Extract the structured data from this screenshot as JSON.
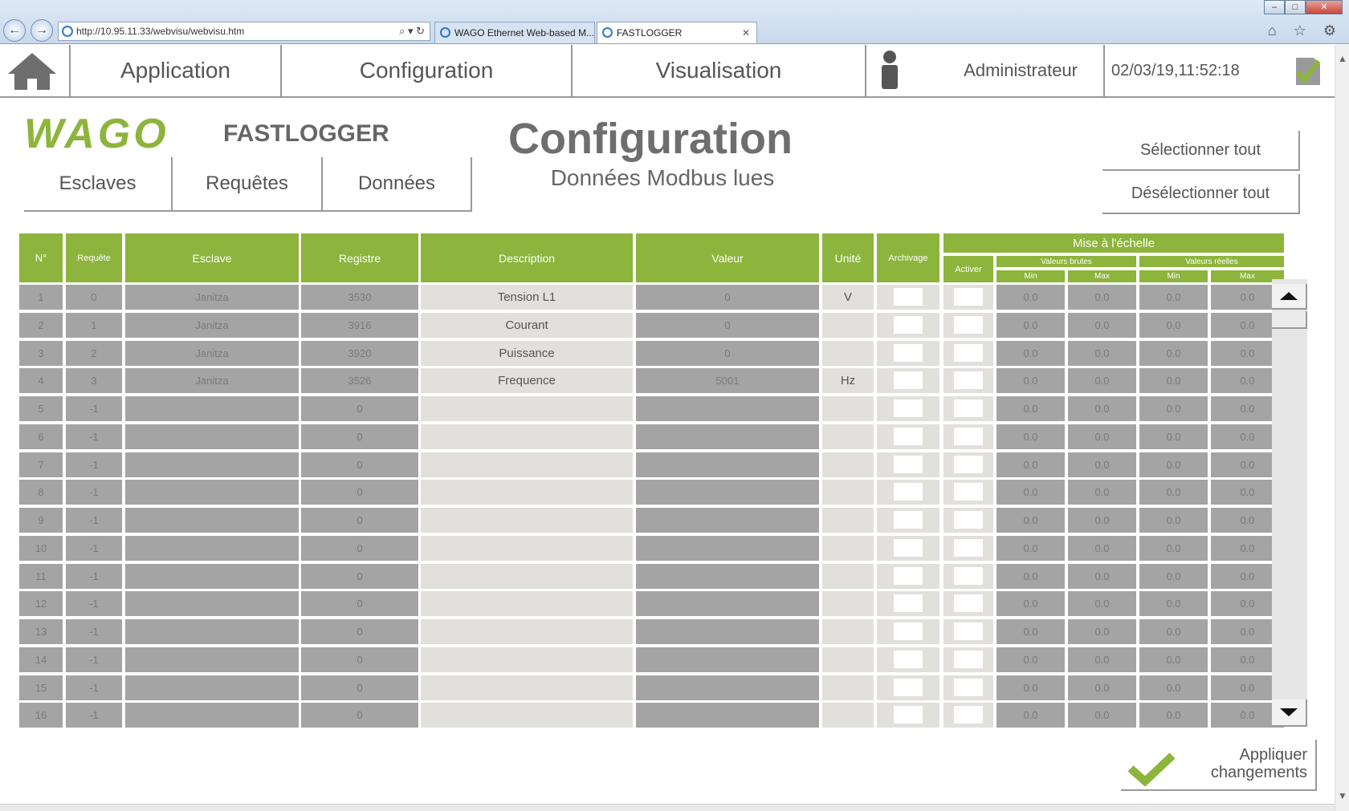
{
  "browser": {
    "address": "http://10.95.11.33/webvisu/webvisu.htm",
    "tabs": [
      "WAGO Ethernet Web-based M...",
      "FASTLOGGER"
    ],
    "close_glyph": "✕",
    "back_glyph": "←",
    "forward_glyph": "→",
    "toolbar_glyphs": "⌕ ▾ ↻",
    "right_glyphs": "⌂ ☆ ⚙"
  },
  "menu": {
    "application": "Application",
    "configuration": "Configuration",
    "visualisation": "Visualisation",
    "user": "Administrateur",
    "datetime": "02/03/19,11:52:18"
  },
  "header": {
    "logo_text": "WAGO",
    "app_name": "FASTLOGGER",
    "title": "Configuration",
    "subtitle": "Données Modbus lues",
    "subtabs": [
      "Esclaves",
      "Requêtes",
      "Données"
    ],
    "select_all": "Sélectionner tout",
    "deselect_all": "Désélectionner tout"
  },
  "table": {
    "headers": {
      "num": "N°",
      "request": "Requête",
      "slave": "Esclave",
      "register": "Registre",
      "description": "Description",
      "value": "Valeur",
      "unit": "Unité",
      "archive": "Archivage",
      "scaling": "Mise à l'échelle",
      "enable": "Activer",
      "raw": "Valeurs brutes",
      "real": "Valeurs réelles",
      "min": "Min",
      "max": "Max"
    },
    "rows": [
      {
        "n": "1",
        "req": "0",
        "slave": "Janitza",
        "reg": "3530",
        "desc": "Tension L1",
        "val": "0",
        "unit": "V",
        "rmin": "0.0",
        "rmax": "0.0",
        "vmin": "0.0",
        "vmax": "0.0"
      },
      {
        "n": "2",
        "req": "1",
        "slave": "Janitza",
        "reg": "3916",
        "desc": "Courant",
        "val": "0",
        "unit": "",
        "rmin": "0.0",
        "rmax": "0.0",
        "vmin": "0.0",
        "vmax": "0.0"
      },
      {
        "n": "3",
        "req": "2",
        "slave": "Janitza",
        "reg": "3920",
        "desc": "Puissance",
        "val": "0",
        "unit": "",
        "rmin": "0.0",
        "rmax": "0.0",
        "vmin": "0.0",
        "vmax": "0.0"
      },
      {
        "n": "4",
        "req": "3",
        "slave": "Janitza",
        "reg": "3526",
        "desc": "Frequence",
        "val": "5001",
        "unit": "Hz",
        "rmin": "0.0",
        "rmax": "0.0",
        "vmin": "0.0",
        "vmax": "0.0"
      },
      {
        "n": "5",
        "req": "-1",
        "slave": "",
        "reg": "0",
        "desc": "",
        "val": "",
        "unit": "",
        "rmin": "0.0",
        "rmax": "0.0",
        "vmin": "0.0",
        "vmax": "0.0"
      },
      {
        "n": "6",
        "req": "-1",
        "slave": "",
        "reg": "0",
        "desc": "",
        "val": "",
        "unit": "",
        "rmin": "0.0",
        "rmax": "0.0",
        "vmin": "0.0",
        "vmax": "0.0"
      },
      {
        "n": "7",
        "req": "-1",
        "slave": "",
        "reg": "0",
        "desc": "",
        "val": "",
        "unit": "",
        "rmin": "0.0",
        "rmax": "0.0",
        "vmin": "0.0",
        "vmax": "0.0"
      },
      {
        "n": "8",
        "req": "-1",
        "slave": "",
        "reg": "0",
        "desc": "",
        "val": "",
        "unit": "",
        "rmin": "0.0",
        "rmax": "0.0",
        "vmin": "0.0",
        "vmax": "0.0"
      },
      {
        "n": "9",
        "req": "-1",
        "slave": "",
        "reg": "0",
        "desc": "",
        "val": "",
        "unit": "",
        "rmin": "0.0",
        "rmax": "0.0",
        "vmin": "0.0",
        "vmax": "0.0"
      },
      {
        "n": "10",
        "req": "-1",
        "slave": "",
        "reg": "0",
        "desc": "",
        "val": "",
        "unit": "",
        "rmin": "0.0",
        "rmax": "0.0",
        "vmin": "0.0",
        "vmax": "0.0"
      },
      {
        "n": "11",
        "req": "-1",
        "slave": "",
        "reg": "0",
        "desc": "",
        "val": "",
        "unit": "",
        "rmin": "0.0",
        "rmax": "0.0",
        "vmin": "0.0",
        "vmax": "0.0"
      },
      {
        "n": "12",
        "req": "-1",
        "slave": "",
        "reg": "0",
        "desc": "",
        "val": "",
        "unit": "",
        "rmin": "0.0",
        "rmax": "0.0",
        "vmin": "0.0",
        "vmax": "0.0"
      },
      {
        "n": "13",
        "req": "-1",
        "slave": "",
        "reg": "0",
        "desc": "",
        "val": "",
        "unit": "",
        "rmin": "0.0",
        "rmax": "0.0",
        "vmin": "0.0",
        "vmax": "0.0"
      },
      {
        "n": "14",
        "req": "-1",
        "slave": "",
        "reg": "0",
        "desc": "",
        "val": "",
        "unit": "",
        "rmin": "0.0",
        "rmax": "0.0",
        "vmin": "0.0",
        "vmax": "0.0"
      },
      {
        "n": "15",
        "req": "-1",
        "slave": "",
        "reg": "0",
        "desc": "",
        "val": "",
        "unit": "",
        "rmin": "0.0",
        "rmax": "0.0",
        "vmin": "0.0",
        "vmax": "0.0"
      },
      {
        "n": "16",
        "req": "-1",
        "slave": "",
        "reg": "0",
        "desc": "",
        "val": "",
        "unit": "",
        "rmin": "0.0",
        "rmax": "0.0",
        "vmin": "0.0",
        "vmax": "0.0"
      }
    ]
  },
  "apply": {
    "line1": "Appliquer",
    "line2": "changements"
  },
  "colors": {
    "accent_green": "#8db43c",
    "cell_dark": "#a4a4a4",
    "cell_light": "#e2e0dc"
  },
  "icons": [
    "home-icon",
    "user-icon",
    "sd-card-check-icon",
    "checkmark-icon",
    "scroll-up-arrow-icon",
    "scroll-down-arrow-icon"
  ]
}
